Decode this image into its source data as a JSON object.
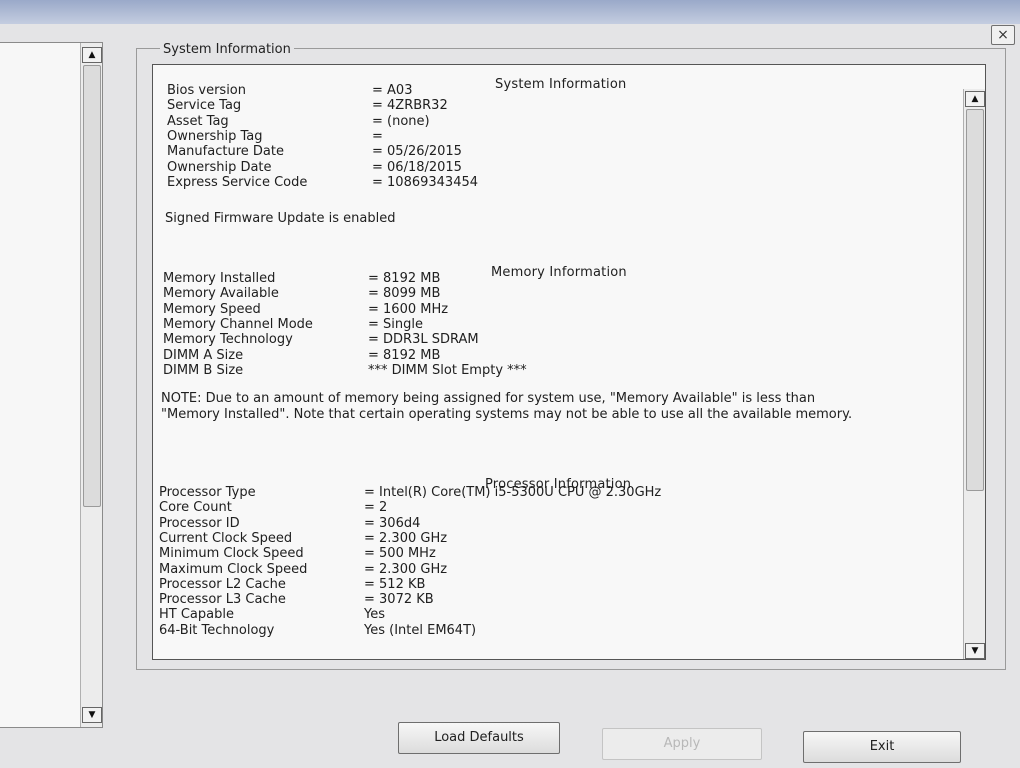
{
  "window": {
    "close_label": "×"
  },
  "groupbox": {
    "legend": "System Information"
  },
  "system": {
    "title": "System Information",
    "rows": [
      {
        "label": "Bios version",
        "value": "= A03"
      },
      {
        "label": "Service Tag",
        "value": "= 4ZRBR32"
      },
      {
        "label": "Asset Tag",
        "value": "= (none)"
      },
      {
        "label": "Ownership Tag",
        "value": "="
      },
      {
        "label": "Manufacture Date",
        "value": "= 05/26/2015"
      },
      {
        "label": "Ownership Date",
        "value": "= 06/18/2015"
      },
      {
        "label": "Express Service Code",
        "value": "= 10869343454"
      }
    ],
    "firmware_note": "Signed Firmware Update is enabled"
  },
  "memory": {
    "title": "Memory Information",
    "rows": [
      {
        "label": "Memory Installed",
        "value": "= 8192 MB"
      },
      {
        "label": "Memory Available",
        "value": "= 8099 MB"
      },
      {
        "label": "Memory Speed",
        "value": "= 1600 MHz"
      },
      {
        "label": "Memory Channel Mode",
        "value": "= Single"
      },
      {
        "label": "Memory Technology",
        "value": "= DDR3L SDRAM"
      },
      {
        "label": "DIMM A Size",
        "value": "= 8192 MB"
      },
      {
        "label": "DIMM B Size",
        "value": "*** DIMM Slot Empty ***"
      }
    ],
    "note": "NOTE: Due to an amount of memory being assigned for system use, \"Memory Available\" is less than \"Memory Installed\". Note that certain operating systems may not be able to use all the available memory."
  },
  "processor": {
    "title": "Processor Information",
    "rows": [
      {
        "label": "Processor Type",
        "value": "= Intel(R) Core(TM) i5-5300U CPU @ 2.30GHz"
      },
      {
        "label": "Core Count",
        "value": "= 2"
      },
      {
        "label": "Processor ID",
        "value": "= 306d4"
      },
      {
        "label": "Current Clock Speed",
        "value": "= 2.300 GHz"
      },
      {
        "label": "Minimum Clock Speed",
        "value": "= 500 MHz"
      },
      {
        "label": "Maximum Clock Speed",
        "value": "= 2.300 GHz"
      },
      {
        "label": "Processor L2 Cache",
        "value": "= 512 KB"
      },
      {
        "label": "Processor L3 Cache",
        "value": "= 3072 KB"
      },
      {
        "label": "HT Capable",
        "value": "Yes"
      },
      {
        "label": "64-Bit Technology",
        "value": "Yes (Intel EM64T)"
      }
    ]
  },
  "buttons": {
    "load_defaults": "Load Defaults",
    "apply": "Apply",
    "exit": "Exit"
  },
  "icons": {
    "scroll_up": "▲",
    "scroll_down": "▼"
  }
}
